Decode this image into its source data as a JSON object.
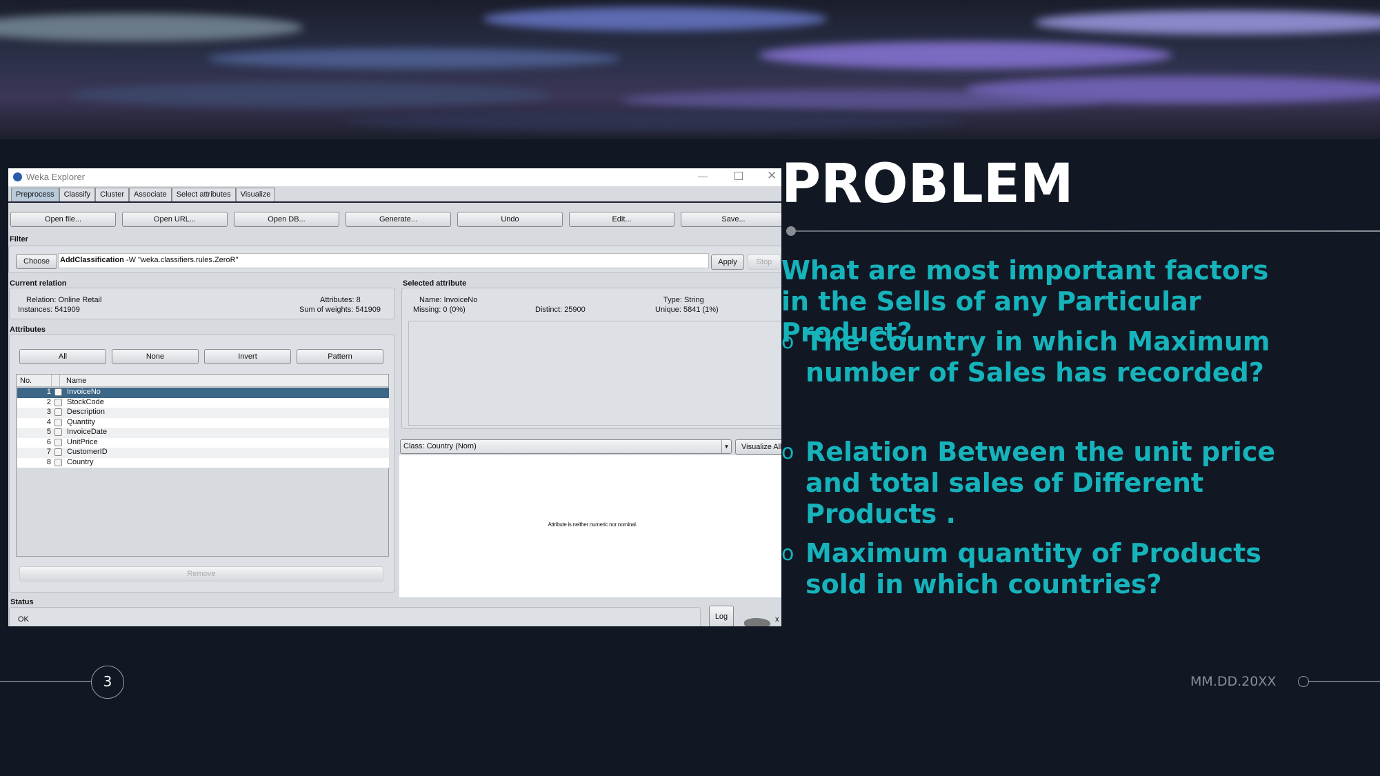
{
  "weka": {
    "window_title": "Weka Explorer",
    "tabs": [
      "Preprocess",
      "Classify",
      "Cluster",
      "Associate",
      "Select attributes",
      "Visualize"
    ],
    "toolbar": [
      "Open file...",
      "Open URL...",
      "Open DB...",
      "Generate...",
      "Undo",
      "Edit...",
      "Save..."
    ],
    "filter": {
      "label": "Filter",
      "choose": "Choose",
      "name": "AddClassification",
      "args": " -W \"weka.classifiers.rules.ZeroR\"",
      "apply": "Apply",
      "stop": "Stop"
    },
    "current_relation": {
      "label": "Current relation",
      "relation": "Relation: Online Retail",
      "instances": "Instances: 541909",
      "attributes": "Attributes: 8",
      "sum_weights": "Sum of weights: 541909"
    },
    "attributes": {
      "label": "Attributes",
      "buttons": [
        "All",
        "None",
        "Invert",
        "Pattern"
      ],
      "col_no": "No.",
      "col_name": "Name",
      "rows": [
        {
          "no": "1",
          "name": "InvoiceNo"
        },
        {
          "no": "2",
          "name": "StockCode"
        },
        {
          "no": "3",
          "name": "Description"
        },
        {
          "no": "4",
          "name": "Quantity"
        },
        {
          "no": "5",
          "name": "InvoiceDate"
        },
        {
          "no": "6",
          "name": "UnitPrice"
        },
        {
          "no": "7",
          "name": "CustomerID"
        },
        {
          "no": "8",
          "name": "Country"
        }
      ],
      "remove": "Remove"
    },
    "selected_attribute": {
      "label": "Selected attribute",
      "name": "Name: InvoiceNo",
      "missing": "Missing: 0 (0%)",
      "distinct": "Distinct: 25900",
      "type": "Type: String",
      "unique": "Unique: 5841 (1%)"
    },
    "class_select": "Class: Country (Nom)",
    "visualize_all": "Visualize All",
    "plot_message": "Attribute is neither numeric nor nominal.",
    "status": {
      "label": "Status",
      "text": "OK",
      "log": "Log",
      "x": "x"
    },
    "selection_color": "#3d6787"
  },
  "slide": {
    "title": "PROBLEM",
    "question": "What are most important factors in the Sells of any Particular Product?",
    "bullets": [
      "The Country in which  Maximum number of Sales has recorded?",
      "Relation Between the unit price and total sales  of Different Products .",
      "Maximum quantity of Products sold in which countries?"
    ],
    "bullet_glyph": "o",
    "page_number": "3",
    "date": "MM.DD.20XX",
    "accent": "#16b3bb"
  }
}
